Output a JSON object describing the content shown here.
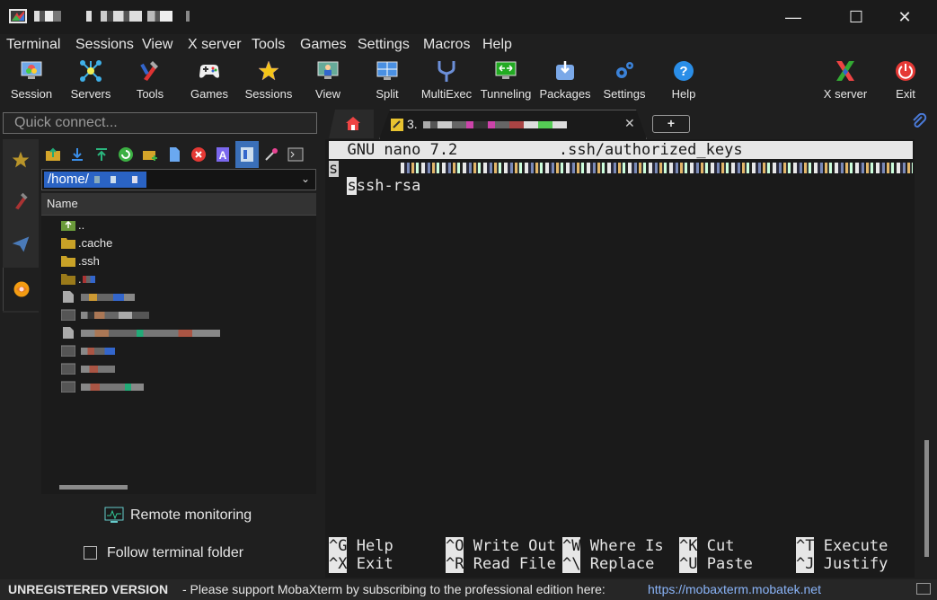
{
  "window": {
    "minimize_glyph": "—",
    "maximize_glyph": "☐",
    "close_glyph": "✕"
  },
  "menu": [
    "Terminal",
    "Sessions",
    "View",
    "X server",
    "Tools",
    "Games",
    "Settings",
    "Macros",
    "Help"
  ],
  "toolbar": {
    "items": [
      {
        "label": "Session",
        "icon": "session-monitor-icon"
      },
      {
        "label": "Servers",
        "icon": "servers-icon"
      },
      {
        "label": "Tools",
        "icon": "tools-icon"
      },
      {
        "label": "Games",
        "icon": "gamepad-icon"
      },
      {
        "label": "Sessions",
        "icon": "star-icon"
      },
      {
        "label": "View",
        "icon": "view-icon"
      },
      {
        "label": "Split",
        "icon": "split-icon"
      },
      {
        "label": "MultiExec",
        "icon": "multiexec-icon"
      },
      {
        "label": "Tunneling",
        "icon": "tunneling-icon"
      },
      {
        "label": "Packages",
        "icon": "packages-icon"
      },
      {
        "label": "Settings",
        "icon": "settings-icon"
      },
      {
        "label": "Help",
        "icon": "help-icon"
      }
    ],
    "right_items": [
      {
        "label": "X server",
        "icon": "x-server-icon"
      },
      {
        "label": "Exit",
        "icon": "power-icon"
      }
    ]
  },
  "quick_connect": {
    "placeholder": "Quick connect..."
  },
  "sftp": {
    "path": "/home/",
    "path_arrow": "⌄",
    "column_header": "Name",
    "files": [
      {
        "name": "..",
        "type": "parent"
      },
      {
        "name": ".cache",
        "type": "folder"
      },
      {
        "name": ".ssh",
        "type": "folder"
      },
      {
        "name": ".",
        "type": "folder"
      },
      {
        "name": "",
        "type": "file"
      },
      {
        "name": "",
        "type": "exec"
      },
      {
        "name": "",
        "type": "file"
      },
      {
        "name": "",
        "type": "exec"
      },
      {
        "name": "",
        "type": "exec"
      },
      {
        "name": "",
        "type": "exec"
      }
    ],
    "remote_monitoring": "Remote monitoring",
    "follow_terminal": "Follow terminal folder"
  },
  "tabs": {
    "active_tab_prefix": "3.",
    "active_tab_close": "✕",
    "new_tab": "+",
    "home_icon": "home-icon",
    "attach_icon": "paperclip-icon"
  },
  "terminal": {
    "nano_header": "  GNU nano 7.2           .ssh/authorized_keys",
    "line1_prefix": "ssh-rsa ",
    "shortcuts_row1": [
      {
        "key": "^G",
        "label": "Help"
      },
      {
        "key": "^O",
        "label": "Write Out"
      },
      {
        "key": "^W",
        "label": "Where Is"
      },
      {
        "key": "^K",
        "label": "Cut"
      },
      {
        "key": "^T",
        "label": "Execute"
      }
    ],
    "shortcuts_row2": [
      {
        "key": "^X",
        "label": "Exit"
      },
      {
        "key": "^R",
        "label": "Read File"
      },
      {
        "key": "^\\",
        "label": "Replace"
      },
      {
        "key": "^U",
        "label": "Paste"
      },
      {
        "key": "^J",
        "label": "Justify"
      }
    ]
  },
  "status": {
    "unregistered": "UNREGISTERED VERSION",
    "message": "  -  Please support MobaXterm by subscribing to the professional edition here:",
    "link": "https://mobaxterm.mobatek.net"
  },
  "colors": {
    "accent_blue": "#2a63c4",
    "link": "#8ab4f8",
    "folder": "#c9a227"
  }
}
